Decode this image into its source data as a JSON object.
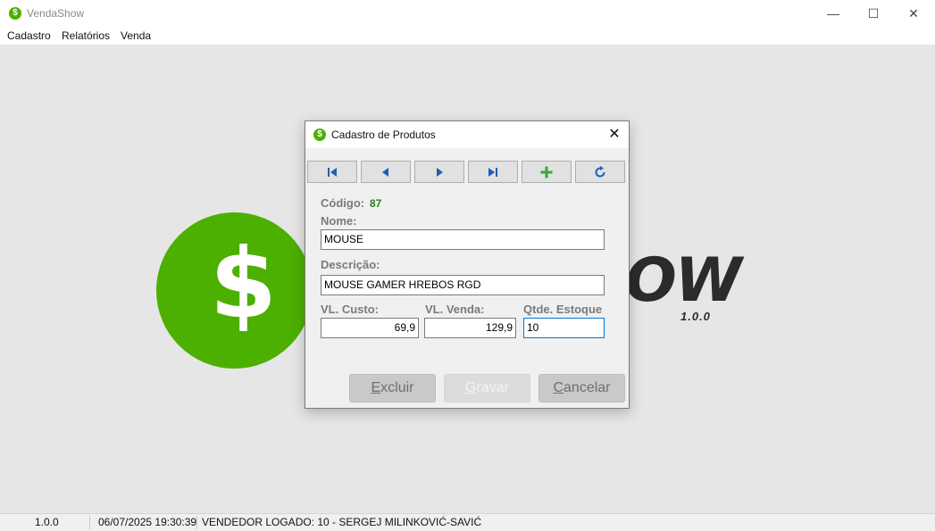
{
  "window": {
    "title": "VendaShow",
    "icon": "dollar-circle-icon",
    "controls": {
      "minimize": "—",
      "maximize": "☐",
      "close": "✕"
    }
  },
  "menu": {
    "items": [
      {
        "label": "Cadastro"
      },
      {
        "label": "Relatórios"
      },
      {
        "label": "Venda"
      }
    ]
  },
  "background_logo": {
    "symbol": "$",
    "text": "OW",
    "version": "1.0.0",
    "brand_color": "#4cb000"
  },
  "dialog": {
    "title": "Cadastro de Produtos",
    "close": "✕",
    "nav_buttons": [
      {
        "name": "first-record-button",
        "icon": "first-icon"
      },
      {
        "name": "previous-record-button",
        "icon": "previous-icon"
      },
      {
        "name": "next-record-button",
        "icon": "next-icon"
      },
      {
        "name": "last-record-button",
        "icon": "last-icon"
      },
      {
        "name": "add-record-button",
        "icon": "plus-icon"
      },
      {
        "name": "refresh-button",
        "icon": "refresh-icon"
      }
    ],
    "codigo_label": "Código:",
    "codigo_value": "87",
    "nome_label": "Nome:",
    "nome_value": "MOUSE",
    "descricao_label": "Descrição:",
    "descricao_value": "MOUSE GAMER HREBOS RGD",
    "custo_label": "VL. Custo:",
    "custo_value": "69,9",
    "venda_label": "VL. Venda:",
    "venda_value": "129,9",
    "estoque_label": "Qtde. Estoque",
    "estoque_value": "10",
    "buttons": {
      "excluir": {
        "first": "E",
        "rest": "xcluir"
      },
      "gravar": {
        "first": "G",
        "rest": "ravar"
      },
      "cancelar": {
        "first": "C",
        "rest": "ancelar"
      }
    }
  },
  "statusbar": {
    "version": "1.0.0",
    "datetime": "06/07/2025 19:30:39",
    "vendedor": "VENDEDOR LOGADO:  10 - SERGEJ MILINKOVIĆ-SAVIĆ"
  }
}
